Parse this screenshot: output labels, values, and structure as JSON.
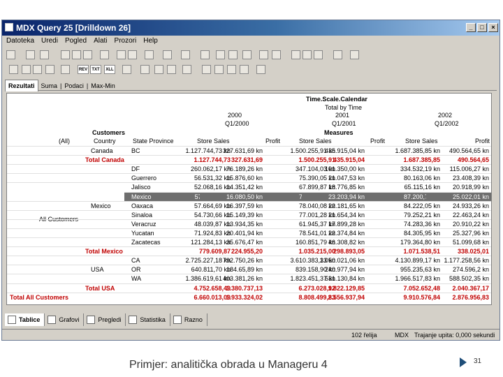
{
  "window": {
    "title": "MDX Query 25 [Drilldown 26]"
  },
  "menu": [
    "Datoteka",
    "Uredi",
    "Pogled",
    "Alati",
    "Prozori",
    "Help"
  ],
  "result_tabs": [
    "Rezultati",
    "Suma",
    "Podaci",
    "Max-Min"
  ],
  "header": {
    "time_dim": "Time.Scale.Calendar",
    "total_by_time": "Total by Time",
    "years": [
      "2000",
      "2001",
      "2002"
    ],
    "quarters": [
      "Q1/2000",
      "Q1/2001",
      "Q1/2002"
    ],
    "customers": "Customers",
    "measures": "Measures",
    "all_label": "(All)",
    "country": "Country",
    "state": "State Province",
    "cols": [
      "Store Sales",
      "Profit",
      "Store Sales",
      "Profit",
      "Store Sales",
      "Profit"
    ]
  },
  "all_customers": "All Customers",
  "rows": [
    {
      "country": "Canada",
      "state": "BC",
      "v": [
        "1.127.744,73 kn",
        "327.631,69 kn",
        "1.500.255,91 kn",
        "435.915,04 kn",
        "1.687.385,85 kn",
        "490.564,65 kn"
      ]
    },
    {
      "total": "Total Canada",
      "v": [
        "1.127.744,73",
        "327.631,69",
        "1.500.255,91",
        "435.915,04",
        "1.687.385,85",
        "490.564,65"
      ]
    },
    {
      "state": "DF",
      "v": [
        "260.062,17 kn",
        "76.189,26 kn",
        "347.104,03 kn",
        "101.350,00 kn",
        "334.532,19 kn",
        "115.006,27 kn"
      ]
    },
    {
      "state": "Guerrero",
      "v": [
        "56.531,32 kn",
        "15.876,60 kn",
        "75.390,05 kn",
        "21.047,53 kn",
        "80.163,06 kn",
        "23.408,39 kn"
      ]
    },
    {
      "state": "Jalisco",
      "v": [
        "52.068,16 kn",
        "14.351,42 kn",
        "67.899,87 kn",
        "18.776,85 kn",
        "65.115,16 kn",
        "20.918,99 kn"
      ]
    },
    {
      "state": "Mexico",
      "sel": true,
      "v": [
        "57.113,98 kn",
        "16.080,50 kn",
        "70.524,75 kn",
        "23.203,94 kn",
        "87.200,70 kn",
        "25.022,01 kn"
      ]
    },
    {
      "country": "Mexico",
      "state": "Oaxaca",
      "v": [
        "57.664,69 kn",
        "16.397,59 kn",
        "78.040,08 kn",
        "22.181,65 kn",
        "84.222,05 kn",
        "24.933,26 kn"
      ]
    },
    {
      "state": "Sinaloa",
      "v": [
        "54.730,66 kn",
        "15.149,39 kn",
        "77.001,28 kn",
        "21.654,34 kn",
        "79.252,21 kn",
        "22.463,24 kn"
      ]
    },
    {
      "state": "Veracruz",
      "v": [
        "48.039,87 kn",
        "13.934,35 kn",
        "61.945,37 kn",
        "17.899,28 kn",
        "74.283,36 kn",
        "20.910,22 kn"
      ]
    },
    {
      "state": "Yucatan",
      "v": [
        "71.924,83 kn",
        "20.401,94 kn",
        "78.541,01 kn",
        "22.374,84 kn",
        "84.305,95 kn",
        "25.327,96 kn"
      ]
    },
    {
      "state": "Zacatecas",
      "v": [
        "121.284,13 kn",
        "35.676,47 kn",
        "160.851,79 kn",
        "46.308,82 kn",
        "179.364,80 kn",
        "51.099,68 kn"
      ]
    },
    {
      "total": "Total Mexico",
      "v": [
        "779.609,87",
        "224.955,20",
        "1.035.215,00",
        "298.893,05",
        "1.071.538,51",
        "338.025,01"
      ]
    },
    {
      "state": "CA",
      "v": [
        "2.725.227,18 kn",
        "792.750,26 kn",
        "3.610.383,33 kn",
        "1.050.021,06 kn",
        "4.130.899,17 kn",
        "1.177.258,56 kn"
      ]
    },
    {
      "country": "USA",
      "state": "OR",
      "v": [
        "640.811,70 kn",
        "184.65,89 kn",
        "839.158,90 kn",
        "240.977,94 kn",
        "955.235,63 kn",
        "274.596,2 kn"
      ]
    },
    {
      "state": "WA",
      "v": [
        "1.386.619,61 kn",
        "403.381,26 kn",
        "1.823.451,37 kn",
        "531.130,84 kn",
        "1.966.517,83 kn",
        "588.502,35 kn"
      ]
    },
    {
      "total": "Total USA",
      "v": [
        "4.752.658,49",
        "1.380.737,13",
        "6.273.028,92",
        "1.822.129,85",
        "7.052.652,48",
        "2.040.367,17"
      ]
    },
    {
      "total": "Total All Customers",
      "v": [
        "6.660.013,09",
        "1.933.324,02",
        "8.808.499,83",
        "2.556.937,94",
        "9.910.576,84",
        "2.876.956,83"
      ]
    }
  ],
  "bottom_tabs": [
    "Tablice",
    "Grafovi",
    "Pregledi",
    "Statistika",
    "Razno"
  ],
  "status": {
    "rows": "102 řelija",
    "mode": "MDX",
    "duration": "Trajanje upita: 0,000 sekundi"
  },
  "slide": {
    "caption": "Primjer: analitička obrada u Manageru 4",
    "page": "31"
  }
}
